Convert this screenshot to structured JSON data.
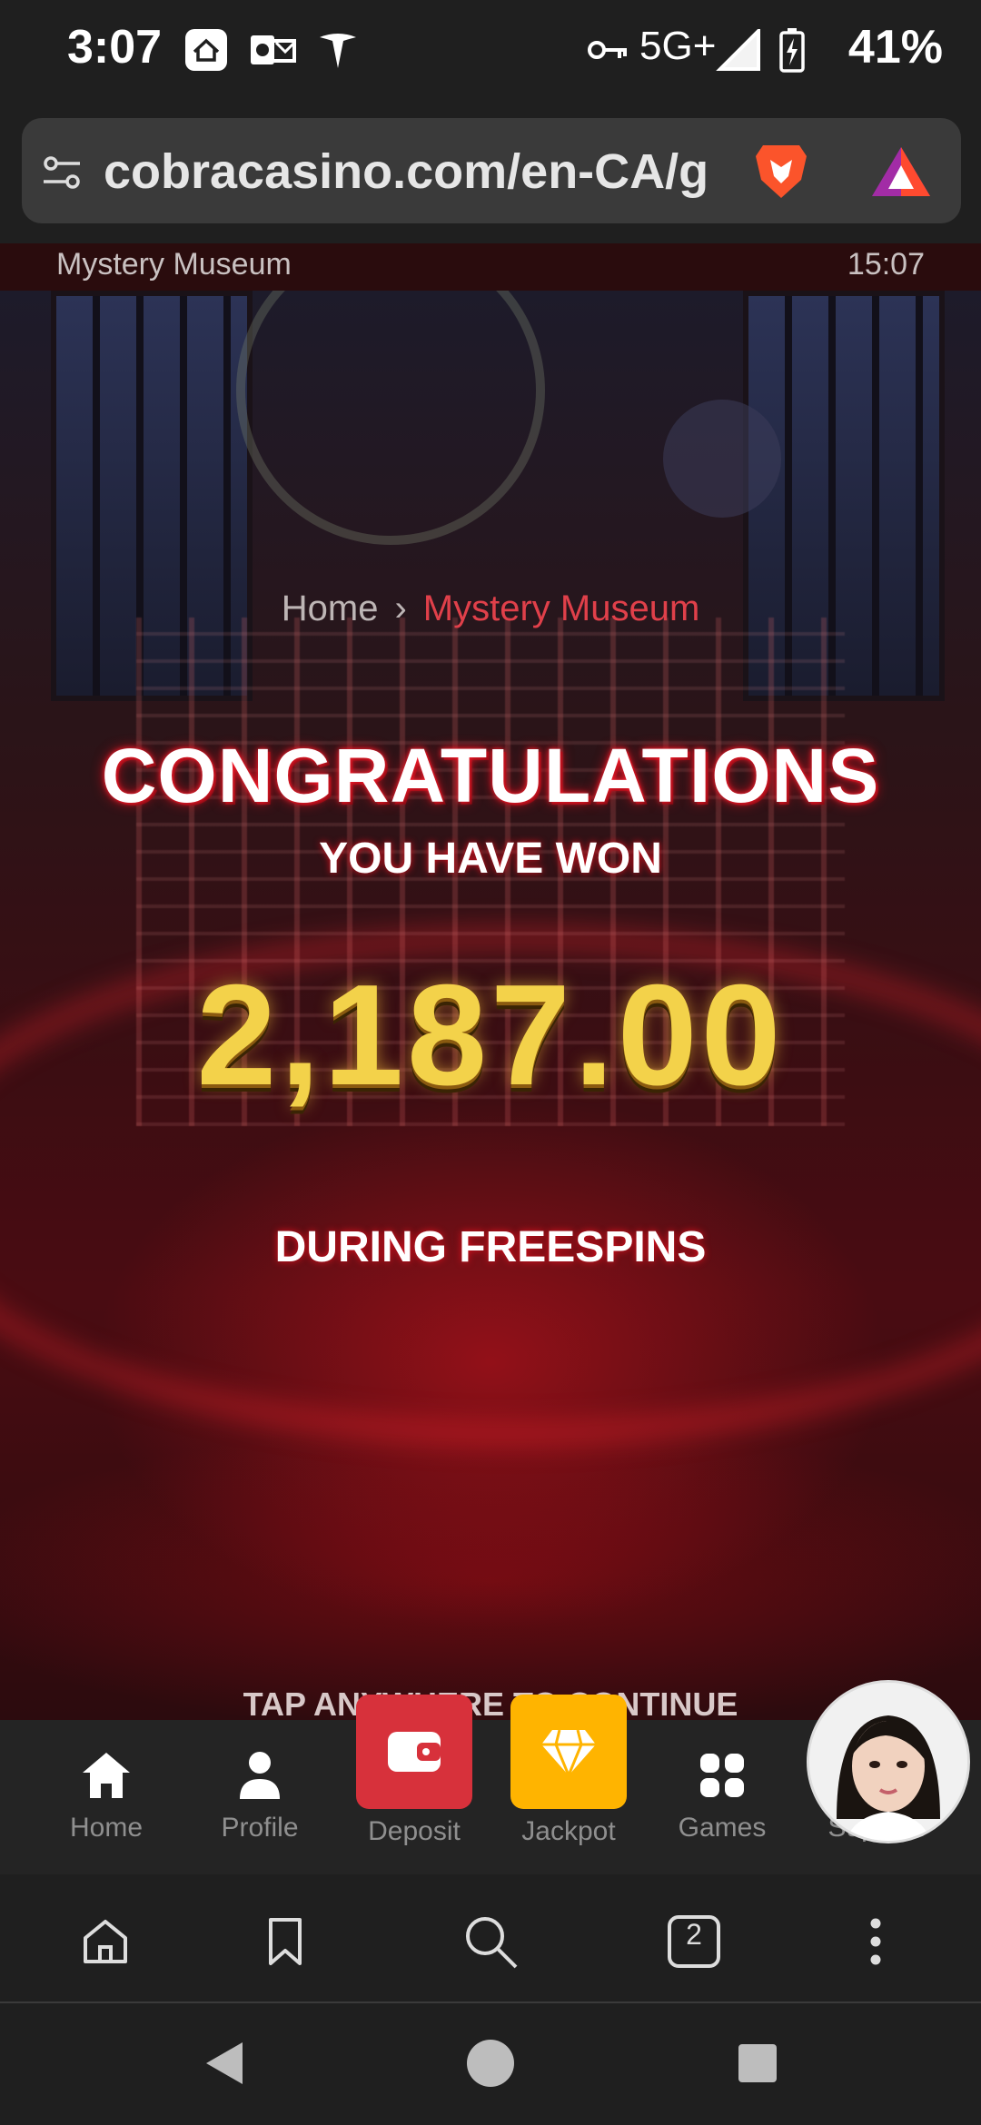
{
  "status_bar": {
    "time": "3:07",
    "network": "5G+",
    "battery": "41%",
    "icons": [
      "home-app-icon",
      "outlook-icon",
      "tesla-icon",
      "vpn-key-icon",
      "signal-icon",
      "battery-charging-icon"
    ]
  },
  "browser": {
    "url": "cobracasino.com/en-CA/g",
    "icons": [
      "site-settings-icon",
      "brave-lion-icon",
      "brave-rewards-icon"
    ]
  },
  "game": {
    "title": "Mystery Museum",
    "clock": "15:07"
  },
  "breadcrumb": {
    "home": "Home",
    "separator": "›",
    "current": "Mystery Museum"
  },
  "win_screen": {
    "heading": "CONGRATULATIONS",
    "subheading": "YOU HAVE WON",
    "amount": "2,187.00",
    "context": "DURING FREESPINS",
    "prompt": "TAP ANYWHERE TO CONTINUE"
  },
  "app_nav": {
    "items": [
      {
        "label": "Home",
        "icon": "home-icon"
      },
      {
        "label": "Profile",
        "icon": "profile-icon"
      },
      {
        "label": "Deposit",
        "icon": "wallet-icon"
      },
      {
        "label": "Jackpot",
        "icon": "diamond-icon"
      },
      {
        "label": "Games",
        "icon": "grid-icon"
      },
      {
        "label": "Support",
        "icon": "support-avatar"
      }
    ],
    "colors": {
      "deposit": "#d7313b",
      "jackpot": "#ffb400"
    }
  },
  "browser_toolbar": {
    "tab_count": "2",
    "icons": [
      "home-outline-icon",
      "bookmark-icon",
      "search-icon",
      "tabs-icon",
      "more-icon"
    ]
  },
  "system_nav": {
    "icons": [
      "back-icon",
      "home-circle-icon",
      "recents-icon"
    ]
  }
}
